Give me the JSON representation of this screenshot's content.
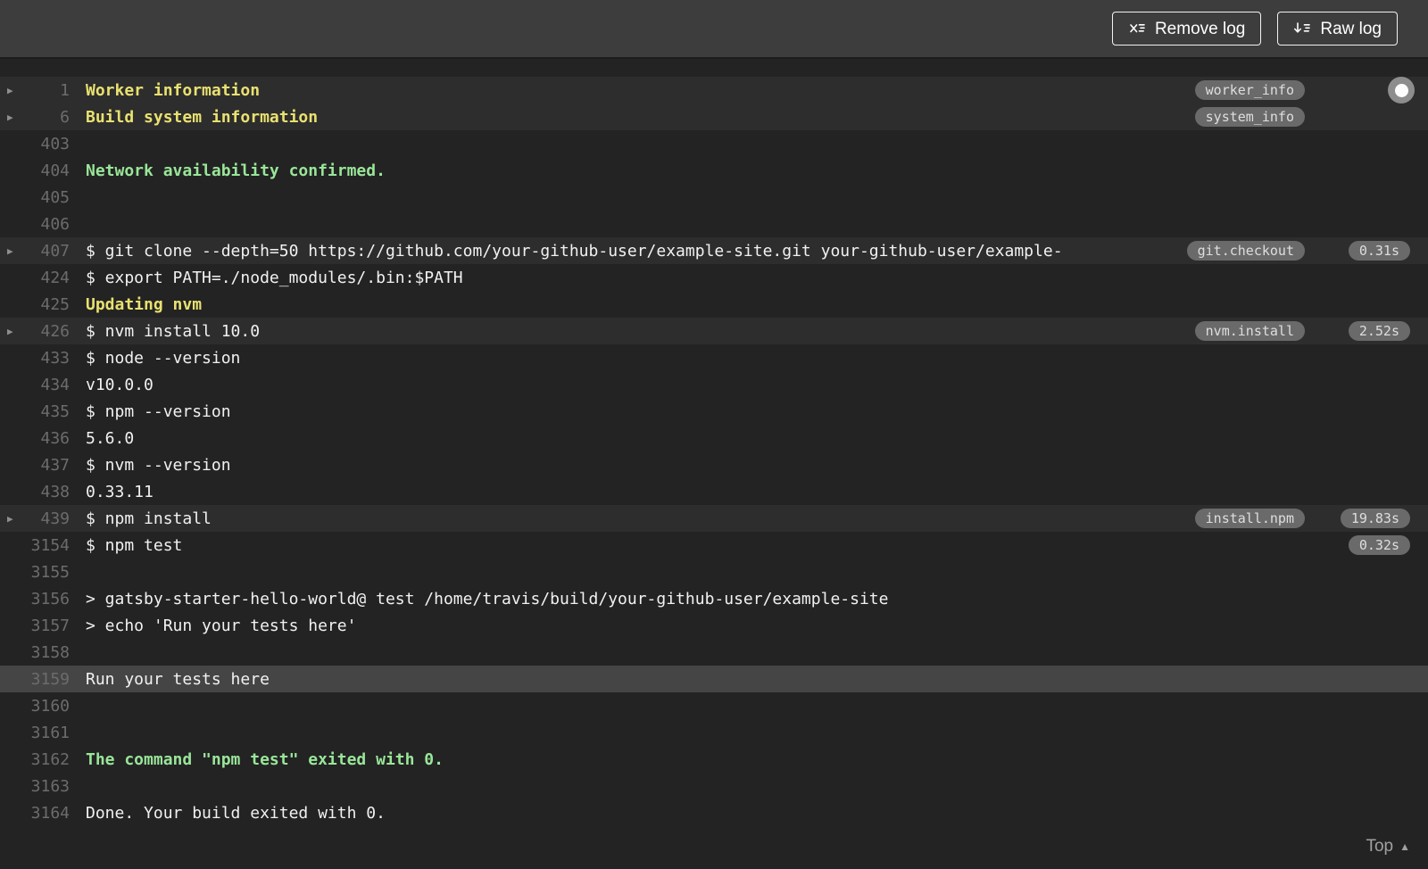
{
  "toolbar": {
    "remove_log_label": "Remove log",
    "raw_log_label": "Raw log",
    "remove_log_icon": "x-list-icon",
    "raw_log_icon": "arrow-down-list-icon"
  },
  "footer": {
    "top_label": "Top",
    "top_icon": "triangle-up-icon"
  },
  "colors": {
    "topbar_bg": "#3d3d3d",
    "log_bg": "#232323",
    "fold_row_bg": "#2d2d2d",
    "selected_row_bg": "#454545",
    "text": "#f1f1f1",
    "yellow": "#e9e170",
    "green": "#99e699",
    "line_number": "#6c6c6c",
    "pill_bg": "#6a6a6a",
    "pill_text": "#dedede"
  },
  "log": {
    "rows": [
      {
        "num": "1",
        "text": "Worker information",
        "style": "yellow",
        "fold": true,
        "header": true,
        "tag": "worker_info",
        "indicator": true
      },
      {
        "num": "6",
        "text": "Build system information",
        "style": "yellow",
        "fold": true,
        "header": true,
        "tag": "system_info"
      },
      {
        "num": "403",
        "text": ""
      },
      {
        "num": "404",
        "text": "Network availability confirmed.",
        "style": "green"
      },
      {
        "num": "405",
        "text": ""
      },
      {
        "num": "406",
        "text": ""
      },
      {
        "num": "407",
        "text": "$ git clone --depth=50 https://github.com/your-github-user/example-site.git your-github-user/example-",
        "fold": true,
        "header": true,
        "tag": "git.checkout",
        "duration": "0.31s"
      },
      {
        "num": "424",
        "text": "$ export PATH=./node_modules/.bin:$PATH"
      },
      {
        "num": "425",
        "text": "Updating nvm",
        "style": "yellow"
      },
      {
        "num": "426",
        "text": "$ nvm install 10.0",
        "fold": true,
        "header": true,
        "tag": "nvm.install",
        "duration": "2.52s"
      },
      {
        "num": "433",
        "text": "$ node --version"
      },
      {
        "num": "434",
        "text": "v10.0.0"
      },
      {
        "num": "435",
        "text": "$ npm --version"
      },
      {
        "num": "436",
        "text": "5.6.0"
      },
      {
        "num": "437",
        "text": "$ nvm --version"
      },
      {
        "num": "438",
        "text": "0.33.11"
      },
      {
        "num": "439",
        "text": "$ npm install",
        "fold": true,
        "header": true,
        "tag": "install.npm",
        "duration": "19.83s"
      },
      {
        "num": "3154",
        "text": "$ npm test",
        "duration": "0.32s"
      },
      {
        "num": "3155",
        "text": ""
      },
      {
        "num": "3156",
        "text": "> gatsby-starter-hello-world@ test /home/travis/build/your-github-user/example-site"
      },
      {
        "num": "3157",
        "text": "> echo 'Run your tests here'"
      },
      {
        "num": "3158",
        "text": ""
      },
      {
        "num": "3159",
        "text": "Run your tests here",
        "selected": true
      },
      {
        "num": "3160",
        "text": ""
      },
      {
        "num": "3161",
        "text": ""
      },
      {
        "num": "3162",
        "text": "The command \"npm test\" exited with 0.",
        "style": "green"
      },
      {
        "num": "3163",
        "text": ""
      },
      {
        "num": "3164",
        "text": "Done. Your build exited with 0."
      }
    ]
  }
}
